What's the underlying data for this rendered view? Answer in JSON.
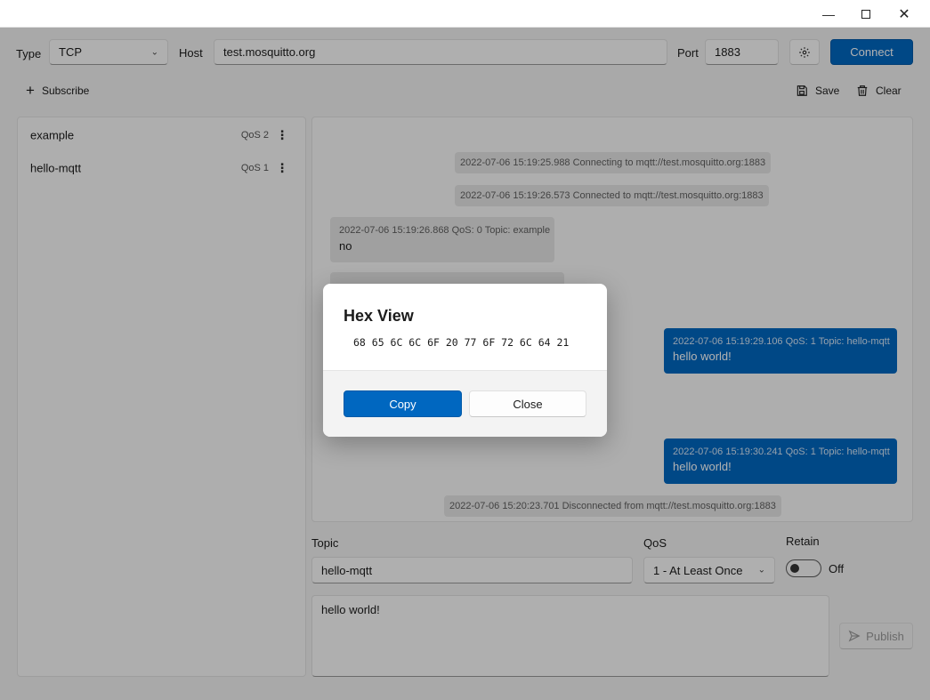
{
  "window": {
    "minimize_icon": "minimize-icon",
    "maximize_icon": "maximize-icon",
    "close_icon": "close-icon"
  },
  "connection": {
    "type_label": "Type",
    "type_value": "TCP",
    "host_label": "Host",
    "host_value": "test.mosquitto.org",
    "port_label": "Port",
    "port_value": "1883",
    "settings_icon": "gear-icon",
    "connect_label": "Connect"
  },
  "toolbar": {
    "subscribe_label": "Subscribe",
    "save_label": "Save",
    "clear_label": "Clear"
  },
  "subscriptions": [
    {
      "topic": "example",
      "qos": "QoS 2"
    },
    {
      "topic": "hello-mqtt",
      "qos": "QoS 1"
    }
  ],
  "messages": {
    "sys1": "2022-07-06 15:19:25.988 Connecting to mqtt://test.mosquitto.org:1883",
    "sys2": "2022-07-06 15:19:26.573 Connected to mqtt://test.mosquitto.org:1883",
    "in1_meta": "2022-07-06 15:19:26.868 QoS: 0 Topic: example",
    "in1_body": "no",
    "out1_meta": "2022-07-06 15:19:29.106 QoS: 1 Topic: hello-mqtt",
    "out1_body": "hello world!",
    "out2_meta": "2022-07-06 15:19:30.241 QoS: 1 Topic: hello-mqtt",
    "out2_body": "hello world!",
    "sys3": "2022-07-06 15:20:23.701 Disconnected from mqtt://test.mosquitto.org:1883"
  },
  "publish": {
    "topic_label": "Topic",
    "topic_value": "hello-mqtt",
    "qos_label": "QoS",
    "qos_value": "1 - At Least Once",
    "retain_label": "Retain",
    "retain_state": "Off",
    "payload": "hello world!",
    "publish_label": "Publish"
  },
  "dialog": {
    "title": "Hex View",
    "hex": "68 65 6C 6C 6F 20 77 6F 72 6C 64 21",
    "copy_label": "Copy",
    "close_label": "Close"
  },
  "colors": {
    "accent": "#0067c0",
    "overlay": "#000000"
  }
}
